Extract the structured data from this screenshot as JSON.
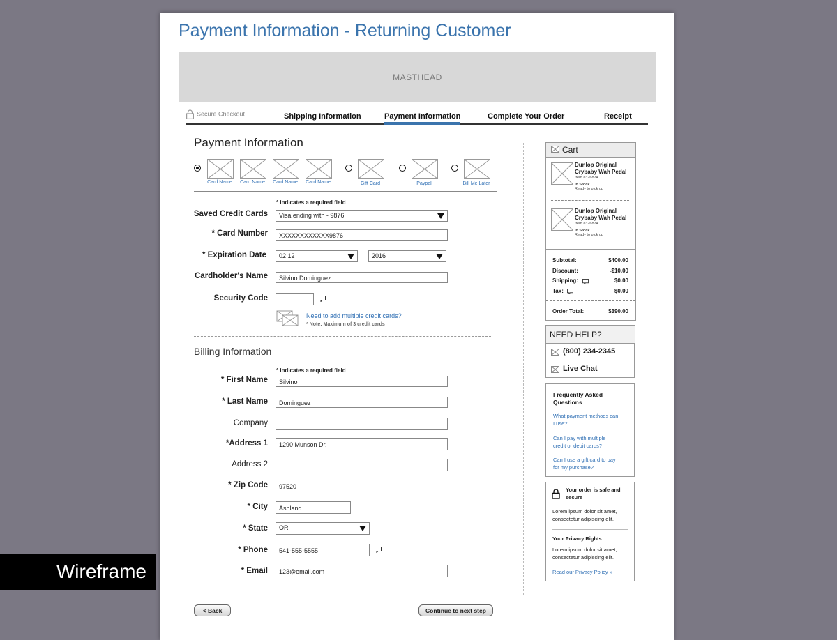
{
  "page_title": "Payment Information - Returning Customer",
  "masthead": "MASTHEAD",
  "steps": {
    "secure": "Secure Checkout",
    "shipping": "Shipping Information",
    "payment": "Payment Information",
    "complete": "Complete Your Order",
    "receipt": "Receipt"
  },
  "payment": {
    "title": "Payment Information",
    "methods": [
      {
        "label": "Card Name"
      },
      {
        "label": "Card Name"
      },
      {
        "label": "Card Name"
      },
      {
        "label": "Card Name"
      },
      {
        "label": "Gift Card"
      },
      {
        "label": "Paypal"
      },
      {
        "label": "Bill Me Later"
      }
    ],
    "required_note": "* indicates a required field",
    "saved_cards_label": "Saved Credit Cards",
    "saved_cards_value": "Visa ending with - 9876",
    "card_number_label": "* Card Number",
    "card_number_value": "XXXXXXXXXXXX9876",
    "expiration_label": "* Expiration Date",
    "exp_month_value": "02 12",
    "exp_year_value": "2016",
    "cardholder_label": "Cardholder's Name",
    "cardholder_value": "Silvino Dominguez",
    "security_label": "Security Code",
    "security_value": "",
    "multi_cards_link": "Need to add multiple credit cards?",
    "multi_cards_note": "* Note: Maximum of 3 credit cards"
  },
  "billing": {
    "title": "Billing Information",
    "required_note": "* indicates a required field",
    "fields": {
      "first_name": {
        "label": "* First Name",
        "value": "Silvino"
      },
      "last_name": {
        "label": "* Last Name",
        "value": "Dominguez"
      },
      "company": {
        "label": "Company",
        "value": ""
      },
      "address1": {
        "label": "*Address 1",
        "value": "1290 Munson Dr."
      },
      "address2": {
        "label": "Address 2",
        "value": ""
      },
      "zip": {
        "label": "* Zip Code",
        "value": "97520"
      },
      "city": {
        "label": "* City",
        "value": "Ashland"
      },
      "state": {
        "label": "* State",
        "value": "OR"
      },
      "phone": {
        "label": "* Phone",
        "value": "541-555-5555"
      },
      "email": {
        "label": "* Email",
        "value": "123@email.com"
      }
    }
  },
  "buttons": {
    "back": "< Back",
    "continue": "Continue to next step"
  },
  "cart": {
    "title": "Cart",
    "items": [
      {
        "name_line1": "Dunlop Original",
        "name_line2": "Crybaby Wah Pedal",
        "item_no": "Item #326874",
        "stock": "In Stock",
        "pickup": "Ready to pick up"
      },
      {
        "name_line1": "Dunlop Original",
        "name_line2": "Crybaby Wah Pedal",
        "item_no": "Item #326874",
        "stock": "In Stock",
        "pickup": "Ready to pick up"
      }
    ],
    "totals": {
      "subtotal_label": "Subtotal:",
      "subtotal_value": "$400.00",
      "discount_label": "Discount:",
      "discount_value": "-$10.00",
      "shipping_label": "Shipping:",
      "shipping_value": "$0.00",
      "tax_label": "Tax:",
      "tax_value": "$0.00",
      "order_total_label": "Order Total:",
      "order_total_value": "$390.00"
    }
  },
  "help": {
    "title": "NEED HELP?",
    "phone": "(800) 234-2345",
    "chat": "Live Chat"
  },
  "faq": {
    "title_line1": "Frequently Asked",
    "title_line2": "Questions",
    "q1_line1": "What payment methods can",
    "q1_line2": "I use?",
    "q2_line1": "Can I pay with multiple",
    "q2_line2": "credit or debit cards?",
    "q3_line1": "Can I use a gift card to pay",
    "q3_line2": "for my purchase?"
  },
  "security": {
    "safe_line1": "Your order is safe and",
    "safe_line2": "secure",
    "lorem1_line1": "Lorem ipsum dolor sit amet,",
    "lorem1_line2": "consectetur adipiscing elit.",
    "privacy_title": "Your Privacy Rights",
    "lorem2_line1": "Lorem ipsum dolor sit amet,",
    "lorem2_line2": "consectetur adipiscing elit.",
    "privacy_link": "Read our Privacy Policy »"
  },
  "badge": "Wireframe",
  "colors": {
    "accent": "#3b74ad",
    "link": "#2f6fb4",
    "background": "#7b7884"
  }
}
